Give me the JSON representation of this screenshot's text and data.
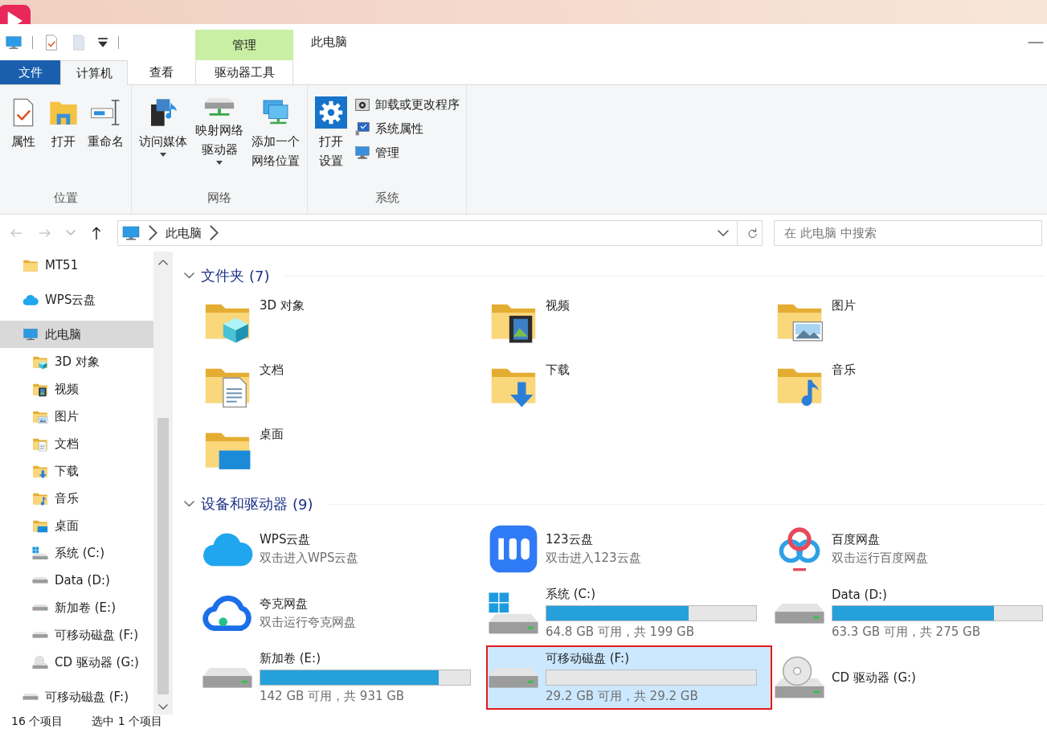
{
  "title_bar": {
    "title": "此电脑",
    "context_header": "管理"
  },
  "tabs": [
    {
      "label": "文件",
      "kind": "file",
      "selected": false
    },
    {
      "label": "计算机",
      "kind": "normal",
      "selected": true
    },
    {
      "label": "查看",
      "kind": "normal",
      "selected": false
    },
    {
      "label": "驱动器工具",
      "kind": "context",
      "selected": false
    }
  ],
  "ribbon_groups": [
    {
      "label": "位置",
      "large": [
        {
          "lines": [
            "属性"
          ],
          "dropdown": false
        },
        {
          "lines": [
            "打开"
          ],
          "dropdown": false
        },
        {
          "lines": [
            "重命名"
          ],
          "dropdown": false
        }
      ]
    },
    {
      "label": "网络",
      "large": [
        {
          "lines": [
            "访问媒体"
          ],
          "dropdown": true
        },
        {
          "lines": [
            "映射网络",
            "驱动器"
          ],
          "dropdown": true
        },
        {
          "lines": [
            "添加一个",
            "网络位置"
          ],
          "dropdown": false
        }
      ]
    },
    {
      "label": "系统",
      "large": [
        {
          "lines": [
            "打开",
            "设置"
          ],
          "dropdown": false
        }
      ],
      "small": [
        {
          "label": "卸载或更改程序"
        },
        {
          "label": "系统属性"
        },
        {
          "label": "管理"
        }
      ]
    }
  ],
  "nav_buttons": [
    {
      "kind": "back",
      "disabled": true
    },
    {
      "kind": "forward",
      "disabled": true
    },
    {
      "kind": "recent",
      "disabled": true
    },
    {
      "kind": "up",
      "disabled": false
    }
  ],
  "address": {
    "path": [
      "此电脑"
    ],
    "search_placeholder": "在 此电脑 中搜索"
  },
  "nav_tree": [
    {
      "label": "MT51",
      "selected": false
    },
    {
      "label": "WPS云盘",
      "selected": false
    },
    {
      "label": "此电脑",
      "selected": true,
      "children": [
        {
          "label": "3D 对象",
          "selected": false
        },
        {
          "label": "视频",
          "selected": false
        },
        {
          "label": "图片",
          "selected": false
        },
        {
          "label": "文档",
          "selected": false
        },
        {
          "label": "下载",
          "selected": false
        },
        {
          "label": "音乐",
          "selected": false
        },
        {
          "label": "桌面",
          "selected": false
        },
        {
          "label": "系统 (C:)",
          "selected": false
        },
        {
          "label": "Data (D:)",
          "selected": false
        },
        {
          "label": "新加卷 (E:)",
          "selected": false
        },
        {
          "label": "可移动磁盘 (F:)",
          "selected": false
        },
        {
          "label": "CD 驱动器 (G:)",
          "selected": false
        }
      ]
    },
    {
      "label": "可移动磁盘 (F:)",
      "selected": false
    }
  ],
  "sections": [
    {
      "title": "文件夹",
      "count": "(7)",
      "expanded": true,
      "items": [
        {
          "kind": "folder",
          "name": "3D 对象",
          "selected": false
        },
        {
          "kind": "folder",
          "name": "视频",
          "selected": false
        },
        {
          "kind": "folder",
          "name": "图片",
          "selected": false
        },
        {
          "kind": "folder",
          "name": "文档",
          "selected": false
        },
        {
          "kind": "folder",
          "name": "下载",
          "selected": false
        },
        {
          "kind": "folder",
          "name": "音乐",
          "selected": false
        },
        {
          "kind": "folder",
          "name": "桌面",
          "selected": false
        }
      ]
    },
    {
      "title": "设备和驱动器",
      "count": "(9)",
      "expanded": true,
      "items": [
        {
          "kind": "app",
          "name": "WPS云盘",
          "subtitle": "双击进入WPS云盘",
          "selected": false
        },
        {
          "kind": "app",
          "name": "123云盘",
          "subtitle": "双击进入123云盘",
          "selected": false
        },
        {
          "kind": "app",
          "name": "百度网盘",
          "subtitle": "双击运行百度网盘",
          "selected": false
        },
        {
          "kind": "app",
          "name": "夸克网盘",
          "subtitle": "双击运行夸克网盘",
          "selected": false
        },
        {
          "kind": "drive",
          "name": "系统 (C:)",
          "subtitle": "64.8 GB 可用，共 199 GB",
          "level": 0.68,
          "selected": false
        },
        {
          "kind": "drive",
          "name": "Data (D:)",
          "subtitle": "63.3 GB 可用，共 275 GB",
          "level": 0.77,
          "selected": false
        },
        {
          "kind": "drive",
          "name": "新加卷 (E:)",
          "subtitle": "142 GB 可用，共 931 GB",
          "level": 0.85,
          "selected": false
        },
        {
          "kind": "drive",
          "name": "可移动磁盘 (F:)",
          "subtitle": "29.2 GB 可用，共 29.2 GB",
          "selected": true,
          "outlined": true
        },
        {
          "kind": "device",
          "name": "CD 驱动器 (G:)",
          "selected": false
        }
      ]
    }
  ],
  "status_bar": [
    "16 个项目",
    "选中 1 个项目"
  ]
}
